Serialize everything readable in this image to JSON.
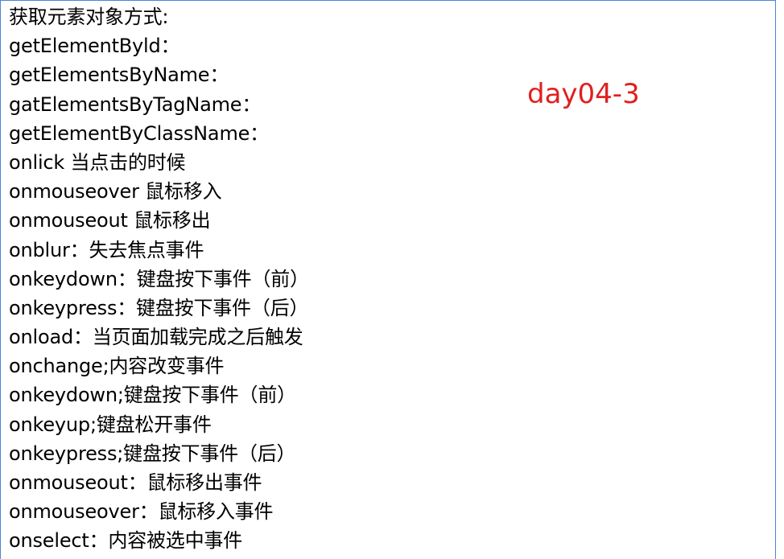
{
  "notes": {
    "lines": [
      "获取元素对象方式:",
      "getElementByld：",
      "getElementsByName：",
      "gatElementsByTagName：",
      "getElementByClassName：",
      "onlick 当点击的时候",
      "onmouseover 鼠标移入",
      "onmouseout 鼠标移出",
      "onblur：失去焦点事件",
      "onkeydown：键盘按下事件（前）",
      "onkeypress：键盘按下事件（后）",
      "onload：当页面加载完成之后触发",
      "onchange;内容改变事件",
      "onkeydown;键盘按下事件（前）",
      "onkeyup;键盘松开事件",
      "onkeypress;键盘按下事件（后）",
      "onmouseout：鼠标移出事件",
      "onmouseover：鼠标移入事件",
      "onselect：内容被选中事件"
    ]
  },
  "stamp": {
    "label": "day04-3",
    "color": "#e02020"
  },
  "frame": {
    "border_color": "#4a86d8"
  }
}
